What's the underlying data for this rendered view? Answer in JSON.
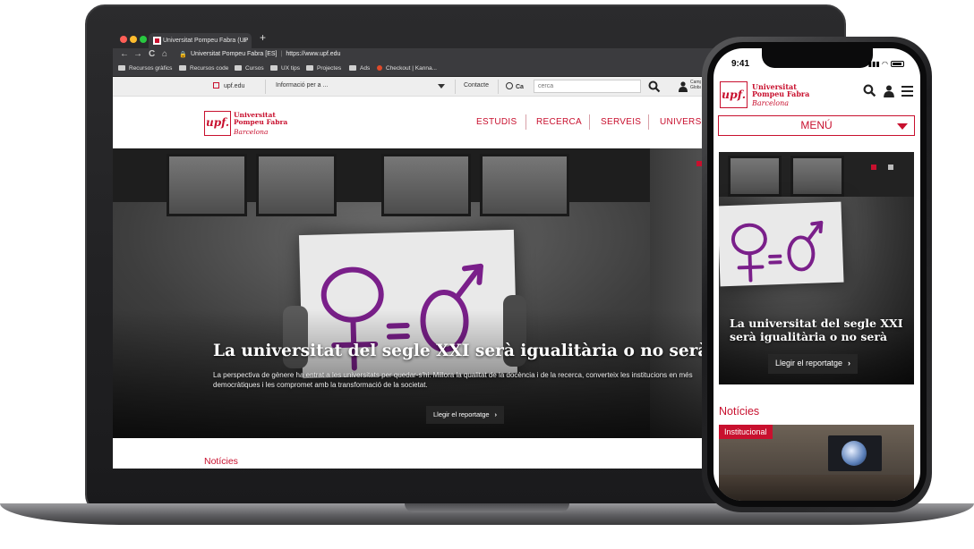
{
  "browser": {
    "tab_title": "Universitat Pompeu Fabra (UP",
    "tab_close": "×",
    "new_tab": "+",
    "site_name": "Universitat Pompeu Fabra [ES]",
    "url": "https://www.upf.edu",
    "back": "←",
    "forward": "→",
    "reload": "C",
    "home": "⌂",
    "lock": "🔒",
    "bookmarks": [
      "Recursos gràfics",
      "Recursos code",
      "Cursos",
      "UX tips",
      "Projectes",
      "Ads",
      "Checkout | Kanna..."
    ],
    "colors": {
      "close": "#ff5f57",
      "minimize": "#febc2e",
      "maximize": "#28c840"
    }
  },
  "utility": {
    "site_link": "upf.edu",
    "info_dropdown": "Informació per a ...",
    "contact": "Contacte",
    "language": "Ca",
    "search_placeholder": "cerca",
    "campus_global": "Campus Global"
  },
  "logo": {
    "mark": "upf.",
    "name_line1": "Universitat",
    "name_line2": "Pompeu Fabra",
    "city": "Barcelona"
  },
  "nav": [
    "ESTUDIS",
    "RECERCA",
    "SERVEIS",
    "UNIVERSITAT"
  ],
  "hero": {
    "title": "La universitat del segle XXI serà igualitària o no serà",
    "text": "La perspectiva de gènere ha entrat a les universitats per quedar-s'hi. Millora la qualitat de la docència i de la recerca, converteix les institucions en més democràtiques i les compromet amb la transformació de la societat.",
    "button": "Llegir el reportatge",
    "chevron": "›"
  },
  "news_heading": "Notícies",
  "phone": {
    "time": "9:41",
    "signal": "▮▮▮ ◠",
    "search_icon": "search-icon",
    "user_icon": "user-icon",
    "menu_icon": "hamburger-icon",
    "menu_label": "MENÚ",
    "hero_title": "La universitat del segle XXI serà igualitària o no serà",
    "hero_button": "Llegir el reportatge",
    "news_heading": "Notícies",
    "news_tag": "Institucional"
  },
  "colors": {
    "brand": "#c8102e",
    "hero_text": "#ffffff",
    "sign_ink": "#7a1f8a"
  }
}
